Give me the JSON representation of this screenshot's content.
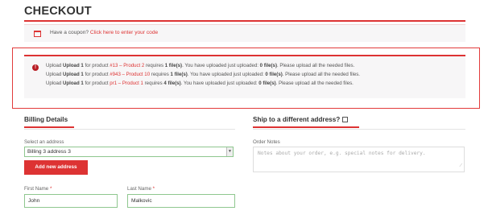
{
  "page": {
    "title": "CHECKOUT"
  },
  "coupon": {
    "prompt": "Have a coupon?",
    "link": "Click here to enter your code"
  },
  "errors": [
    {
      "t1": "Upload ",
      "b1": "Upload 1",
      "t2": " for product ",
      "link": "#13 – Product 2",
      "t3": " requires ",
      "b2": "1 file(s)",
      "t4": ". You have uploaded just uploaded: ",
      "b3": "0 file(s)",
      "t5": ". Please upload all the needed files."
    },
    {
      "t1": "Upload ",
      "b1": "Upload 1",
      "t2": " for product ",
      "link": "#943 – Product 10",
      "t3": " requires ",
      "b2": "1 file(s)",
      "t4": ". You have uploaded just uploaded: ",
      "b3": "0 file(s)",
      "t5": ". Please upload all the needed files."
    },
    {
      "t1": "Upload ",
      "b1": "Upload 1",
      "t2": " for product ",
      "link": "pr1 – Product 1",
      "t3": " requires ",
      "b2": "4 file(s)",
      "t4": ". You have uploaded just uploaded: ",
      "b3": "0 file(s)",
      "t5": ". Please upload all the needed files."
    }
  ],
  "billing": {
    "heading": "Billing Details",
    "select_label": "Select an address",
    "selected_address": "Billing 3 address 3",
    "add_button": "Add new address",
    "first_name_label": "First Name",
    "first_name_value": "John",
    "last_name_label": "Last Name",
    "last_name_value": "Malkovic",
    "required_mark": "*"
  },
  "shipping": {
    "heading": "Ship to a different address?",
    "notes_label": "Order Notes",
    "notes_placeholder": "Notes about your order, e.g. special notes for delivery."
  },
  "colors": {
    "accent": "#dd3333",
    "error_icon": "#b81c23",
    "valid_border": "#8fc78f"
  }
}
